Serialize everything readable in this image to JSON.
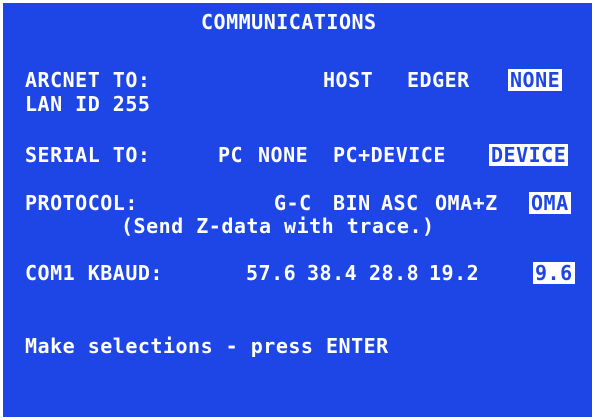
{
  "title": "COMMUNICATIONS",
  "arcnet": {
    "label": "ARCNET TO:",
    "options": [
      {
        "label": "HOST",
        "selected": false
      },
      {
        "label": "EDGER",
        "selected": false
      },
      {
        "label": "NONE",
        "selected": true
      }
    ],
    "lan_id": "LAN ID 255"
  },
  "serial": {
    "label": "SERIAL TO:",
    "options": [
      {
        "label": "PC",
        "selected": false
      },
      {
        "label": "NONE",
        "selected": false
      },
      {
        "label": "PC+DEVICE",
        "selected": false
      },
      {
        "label": "DEVICE",
        "selected": true
      }
    ]
  },
  "protocol": {
    "label": "PROTOCOL:",
    "options": [
      {
        "label": "G-C",
        "selected": false
      },
      {
        "label": "BIN",
        "selected": false
      },
      {
        "label": "ASC",
        "selected": false
      },
      {
        "label": "OMA+Z",
        "selected": false
      },
      {
        "label": "OMA",
        "selected": true
      }
    ],
    "hint": "(Send Z-data with trace.)"
  },
  "com1": {
    "label": "COM1 KBAUD:",
    "options": [
      {
        "label": "57.6",
        "selected": false
      },
      {
        "label": "38.4",
        "selected": false
      },
      {
        "label": "28.8",
        "selected": false
      },
      {
        "label": "19.2",
        "selected": false
      },
      {
        "label": "9.6",
        "selected": true
      }
    ]
  },
  "footer": "Make selections - press ENTER",
  "colors": {
    "background": "#1e46e6",
    "text": "#ffffff",
    "border": "#ffffff"
  }
}
